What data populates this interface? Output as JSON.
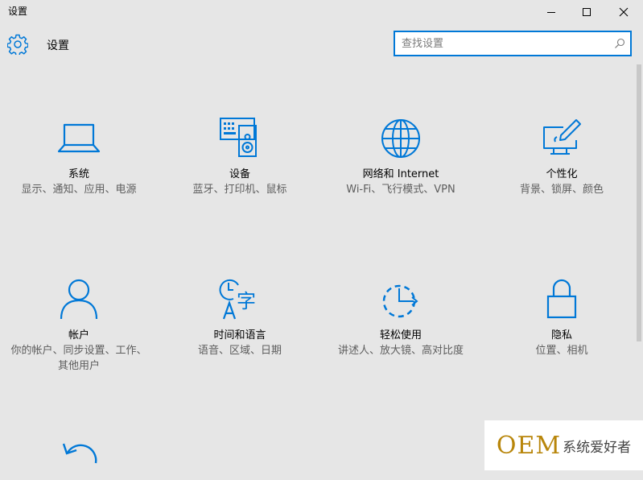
{
  "window": {
    "title": "设置",
    "controls": {
      "minimize": "minimize-icon",
      "maximize": "maximize-icon",
      "close": "close-icon"
    }
  },
  "header": {
    "icon": "gear-icon",
    "title": "设置",
    "search": {
      "placeholder": "查找设置",
      "value": "",
      "icon": "search-icon"
    }
  },
  "tiles": [
    {
      "name": "系统",
      "desc": "显示、通知、应用、电源",
      "icon": "laptop-icon"
    },
    {
      "name": "设备",
      "desc": "蓝牙、打印机、鼠标",
      "icon": "devices-icon"
    },
    {
      "name": "网络和 Internet",
      "desc": "Wi-Fi、飞行模式、VPN",
      "icon": "globe-icon"
    },
    {
      "name": "个性化",
      "desc": "背景、锁屏、颜色",
      "icon": "personalization-icon"
    },
    {
      "name": "帐户",
      "desc": "你的帐户、同步设置、工作、其他用户",
      "icon": "person-icon"
    },
    {
      "name": "时间和语言",
      "desc": "语音、区域、日期",
      "icon": "time-language-icon"
    },
    {
      "name": "轻松使用",
      "desc": "讲述人、放大镜、高对比度",
      "icon": "ease-of-access-icon"
    },
    {
      "name": "隐私",
      "desc": "位置、相机",
      "icon": "lock-icon"
    },
    {
      "name": "",
      "desc": "",
      "icon": "update-icon"
    }
  ],
  "accent_color": "#0078d7",
  "watermark": {
    "oem": "OEM",
    "text": "系统爱好者"
  }
}
